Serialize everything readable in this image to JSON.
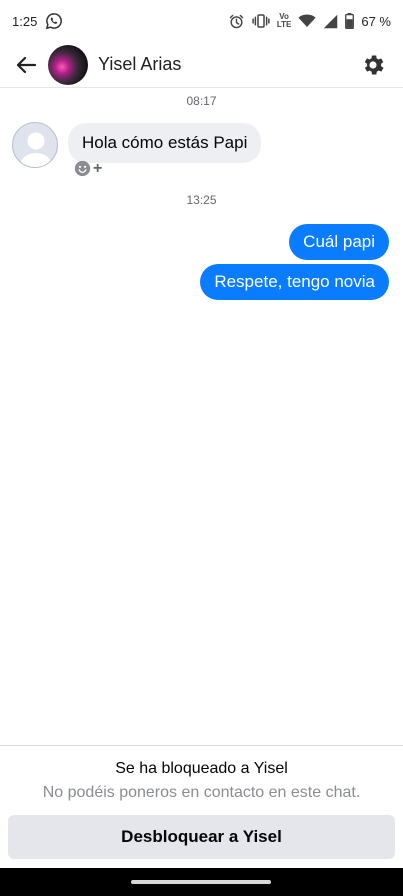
{
  "status_bar": {
    "time": "1:25",
    "battery": "67 %",
    "volte_top": "Vo",
    "volte_bottom": "LTE",
    "icons": [
      "whatsapp-icon",
      "alarm-icon",
      "vibrate-icon",
      "wifi-icon",
      "signal-icon",
      "battery-icon"
    ]
  },
  "header": {
    "contact_name": "Yisel Arias",
    "back_icon": "arrow-left-icon",
    "settings_icon": "gear-icon"
  },
  "conversation": {
    "groups": [
      {
        "timestamp": "08:17",
        "messages": [
          {
            "direction": "incoming",
            "text": "Hola cómo estás Papi"
          }
        ]
      },
      {
        "timestamp": "13:25",
        "messages": [
          {
            "direction": "outgoing",
            "text": "Cuál papi"
          },
          {
            "direction": "outgoing",
            "text": "Respete, tengo novia"
          }
        ]
      }
    ],
    "reaction_icon": "add-reaction-icon",
    "reaction_plus": "+"
  },
  "footer": {
    "blocked_title": "Se ha bloqueado a Yisel",
    "blocked_subtitle": "No podéis poneros en contacto en este chat.",
    "unblock_label": "Desbloquear a Yisel"
  },
  "colors": {
    "outgoing_bubble": "#0a7cff",
    "incoming_bubble": "#eeeff2",
    "button_bg": "#e4e6eb"
  }
}
